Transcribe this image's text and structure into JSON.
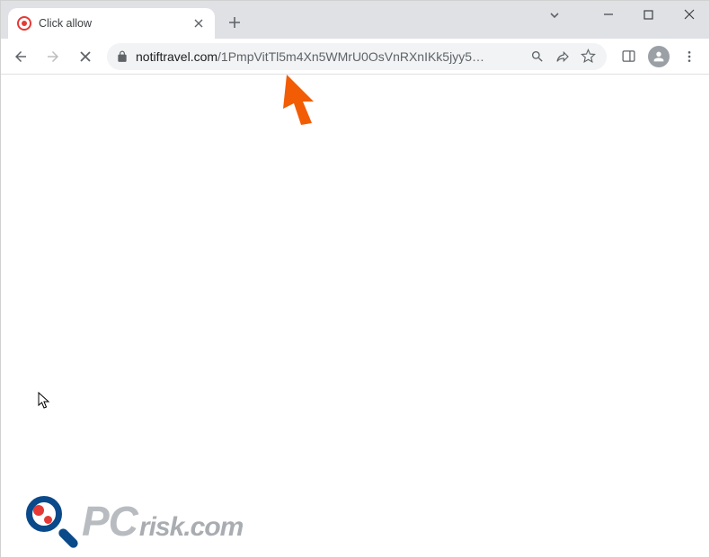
{
  "tab": {
    "title": "Click allow"
  },
  "url": {
    "domain": "notiftravel.com",
    "path": "/1PmpVitTl5m4Xn5WMrU0OsVnRXnIKk5jyy5…"
  },
  "watermark": {
    "pc": "PC",
    "risk": "risk",
    "com": ".com"
  }
}
